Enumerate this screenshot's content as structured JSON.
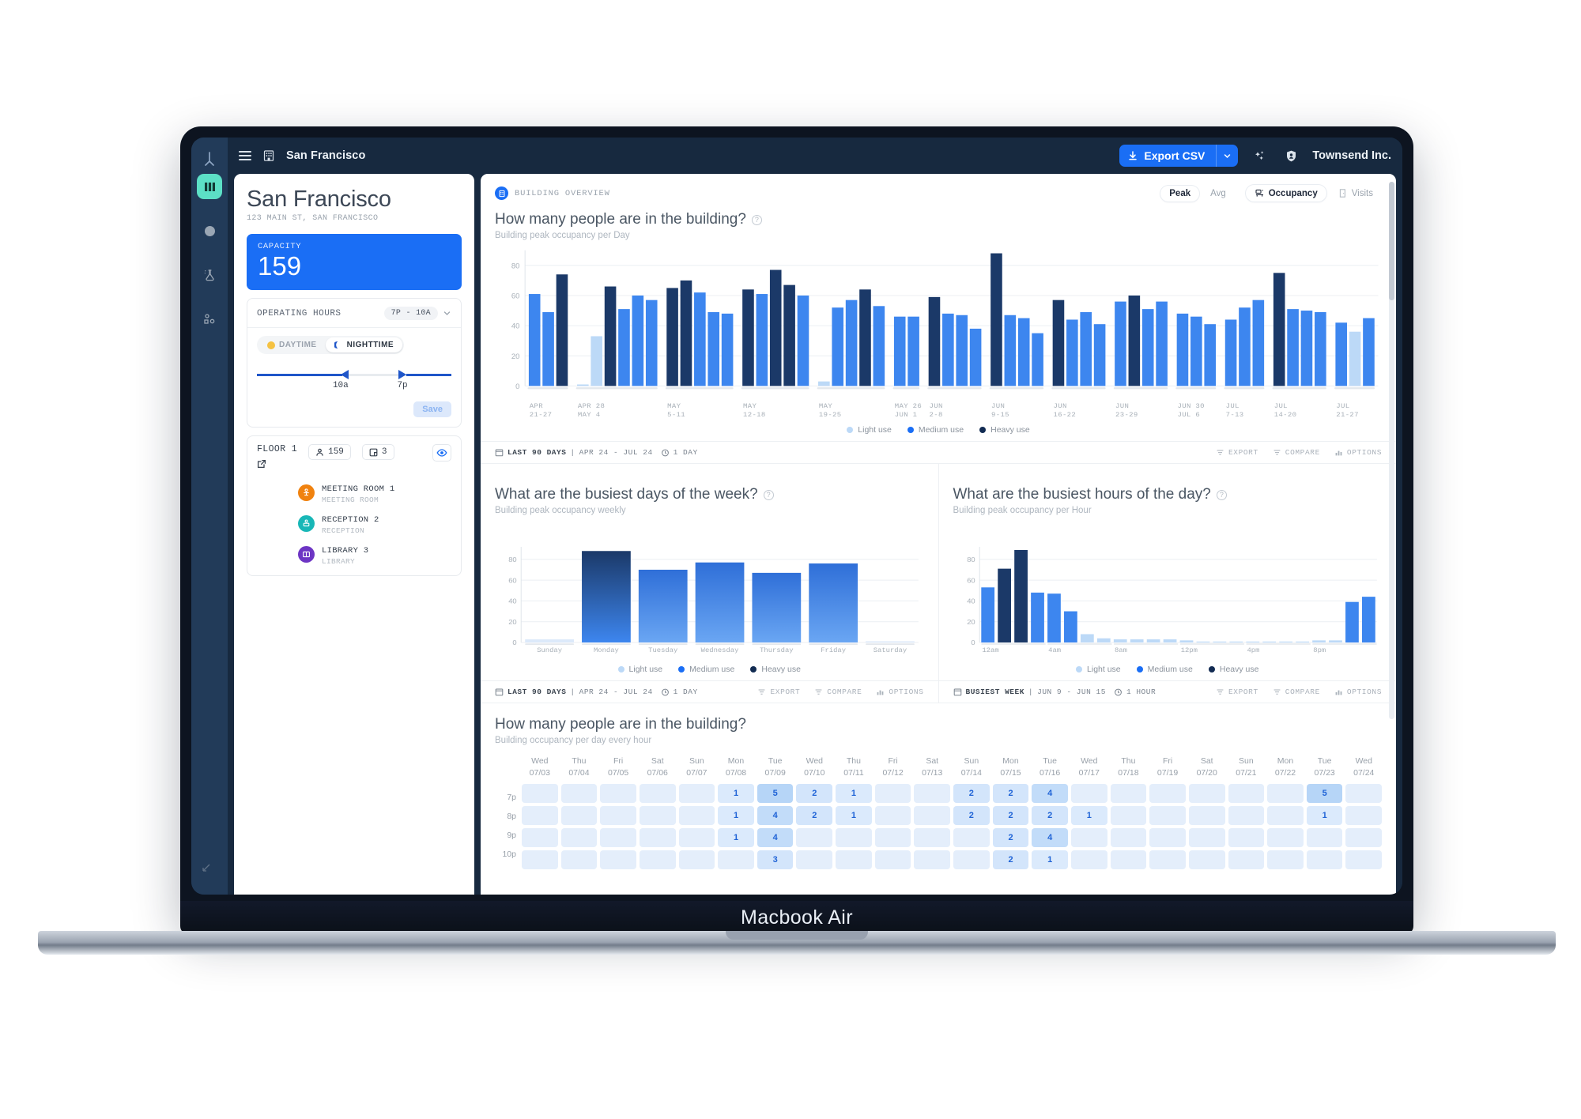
{
  "laptop": {
    "brand": "Macbook Air"
  },
  "topbar": {
    "menu_icon": "hamburger-icon",
    "building_icon": "building-icon",
    "title": "San Francisco",
    "export_label": "Export CSV",
    "export_icon": "download-icon",
    "caret_icon": "chevron-down-icon",
    "sparkle_icon": "sparkles-icon",
    "shield_icon": "shield-icon",
    "org": "Townsend Inc."
  },
  "rail": {
    "logo_icon": "brand-logo-icon",
    "items": [
      {
        "name": "dashboard-icon",
        "active": true
      },
      {
        "name": "circle-dot-icon",
        "active": false
      },
      {
        "name": "lab-flask-icon",
        "active": false
      },
      {
        "name": "nodes-icon",
        "active": false
      }
    ],
    "bottom_icon": "resize-icon"
  },
  "sidebar": {
    "site_title": "San Francisco",
    "address": "123 MAIN ST, SAN FRANCISCO",
    "capacity_label": "CAPACITY",
    "capacity_value": "159",
    "operating_hours": {
      "title": "OPERATING HOURS",
      "badge": "7P - 10A",
      "caret_icon": "chevron-down-icon",
      "daytime_label": "DAYTIME",
      "nighttime_label": "NIGHTTIME",
      "daytime_icon": "sun-icon",
      "nighttime_icon": "moon-icon",
      "active_mode": "NIGHTTIME",
      "slider_start_label": "10a",
      "slider_end_label": "7p",
      "save_label": "Save"
    },
    "floor": {
      "name": "FLOOR 1",
      "open_icon": "external-link-icon",
      "people_icon": "person-icon",
      "people_count": "159",
      "rooms_icon": "rooms-icon",
      "rooms_count": "3",
      "eye_icon": "eye-icon",
      "rooms": [
        {
          "name": "MEETING ROOM 1",
          "type": "MEETING ROOM",
          "color": "#f0820f",
          "icon": "meeting-room-icon"
        },
        {
          "name": "RECEPTION 2",
          "type": "RECEPTION",
          "color": "#18b7b7",
          "icon": "reception-icon"
        },
        {
          "name": "LIBRARY 3",
          "type": "LIBRARY",
          "color": "#6d35c4",
          "icon": "library-icon"
        }
      ]
    }
  },
  "main": {
    "breadcrumb": "BUILDING OVERVIEW",
    "breadcrumb_icon": "building-icon",
    "metric_toggle": {
      "options": [
        "Peak",
        "Avg"
      ],
      "selected": "Peak"
    },
    "view_toggle": {
      "options": [
        "Occupancy",
        "Visits"
      ],
      "selected": "Occupancy",
      "occupancy_icon": "occupancy-icon",
      "visits_icon": "door-icon"
    }
  },
  "legend": [
    {
      "label": "Light use",
      "color": "#bcd9f7"
    },
    {
      "label": "Medium use",
      "color": "#1a6ef5"
    },
    {
      "label": "Heavy use",
      "color": "#122b52"
    }
  ],
  "toolbars": {
    "daily": {
      "calendar_icon": "calendar-icon",
      "range_label": "LAST 90 DAYS",
      "range_dates": "APR 24 - JUL 24",
      "clock_icon": "clock-icon",
      "granularity": "1 DAY",
      "export": "EXPORT",
      "compare": "COMPARE",
      "options": "OPTIONS",
      "export_icon": "filter-icon",
      "compare_icon": "filter-icon",
      "options_icon": "bars-icon"
    },
    "weekly": {
      "calendar_icon": "calendar-icon",
      "range_label": "LAST 90 DAYS",
      "range_dates": "APR 24 - JUL 24",
      "clock_icon": "clock-icon",
      "granularity": "1 DAY",
      "export": "EXPORT",
      "compare": "COMPARE",
      "options": "OPTIONS"
    },
    "hourly": {
      "calendar_icon": "calendar-icon",
      "range_label": "BUSIEST WEEK",
      "range_dates": "JUN 9 - JUN 15",
      "clock_icon": "clock-icon",
      "granularity": "1 HOUR",
      "export": "EXPORT",
      "compare": "COMPARE",
      "options": "OPTIONS"
    }
  },
  "panels": {
    "daily": {
      "title": "How many people are in the building?",
      "subtitle": "Building peak occupancy per Day",
      "help_icon": "question-icon"
    },
    "weekday": {
      "title": "What are the busiest days of the week?",
      "subtitle": "Building peak occupancy weekly",
      "help_icon": "question-icon"
    },
    "hourly": {
      "title": "What are the busiest hours of the day?",
      "subtitle": "Building peak occupancy per Hour",
      "help_icon": "question-icon"
    },
    "heatmap": {
      "title": "How many people are in the building?",
      "subtitle": "Building occupancy per day every hour"
    }
  },
  "chart_data": [
    {
      "id": "daily-occupancy",
      "type": "bar",
      "title": "How many people are in the building?",
      "subtitle": "Building peak occupancy per Day",
      "xlabel": "",
      "ylabel": "",
      "ylim": [
        0,
        90
      ],
      "yticks": [
        0,
        20,
        40,
        60,
        80
      ],
      "grid": true,
      "legend": [
        "Light use",
        "Medium use",
        "Heavy use"
      ],
      "groups": [
        {
          "label": "APR\n21-27",
          "values": [
            61,
            49,
            74
          ],
          "shades": [
            "medium",
            "medium",
            "heavy"
          ]
        },
        {
          "label": "APR 28\nMAY 4",
          "values": [
            1,
            33,
            66,
            51,
            60,
            57
          ],
          "shades": [
            "light",
            "light",
            "heavy",
            "medium",
            "medium",
            "medium"
          ]
        },
        {
          "label": "MAY\n5-11",
          "values": [
            65,
            70,
            62,
            49,
            48
          ],
          "shades": [
            "heavy",
            "heavy",
            "medium",
            "medium",
            "medium"
          ]
        },
        {
          "label": "MAY\n12-18",
          "values": [
            64,
            61,
            77,
            67,
            60
          ],
          "shades": [
            "heavy",
            "medium",
            "heavy",
            "heavy",
            "medium"
          ]
        },
        {
          "label": "MAY\n19-25",
          "values": [
            3,
            52,
            57,
            64,
            53
          ],
          "shades": [
            "light",
            "medium",
            "medium",
            "heavy",
            "medium"
          ]
        },
        {
          "label": "MAY 26\nJUN 1",
          "values": [
            46,
            46
          ],
          "shades": [
            "medium",
            "medium"
          ]
        },
        {
          "label": "JUN\n2-8",
          "values": [
            59,
            48,
            47,
            38
          ],
          "shades": [
            "heavy",
            "medium",
            "medium",
            "medium"
          ]
        },
        {
          "label": "JUN\n9-15",
          "values": [
            88,
            47,
            45,
            35
          ],
          "shades": [
            "heavy",
            "medium",
            "medium",
            "medium"
          ]
        },
        {
          "label": "JUN\n16-22",
          "values": [
            57,
            44,
            49,
            41
          ],
          "shades": [
            "heavy",
            "medium",
            "medium",
            "medium"
          ]
        },
        {
          "label": "JUN\n23-29",
          "values": [
            56,
            60,
            51,
            56
          ],
          "shades": [
            "medium",
            "heavy",
            "medium",
            "medium"
          ]
        },
        {
          "label": "JUN 30\nJUL 6",
          "values": [
            48,
            46,
            41
          ],
          "shades": [
            "medium",
            "medium",
            "medium"
          ]
        },
        {
          "label": "JUL\n7-13",
          "values": [
            44,
            52,
            57
          ],
          "shades": [
            "medium",
            "medium",
            "medium"
          ]
        },
        {
          "label": "JUL\n14-20",
          "values": [
            75,
            51,
            50,
            49
          ],
          "shades": [
            "heavy",
            "medium",
            "medium",
            "medium"
          ]
        },
        {
          "label": "JUL\n21-27",
          "values": [
            42,
            36,
            45
          ],
          "shades": [
            "medium",
            "light",
            "medium"
          ]
        }
      ]
    },
    {
      "id": "busiest-weekdays",
      "type": "bar",
      "title": "What are the busiest days of the week?",
      "subtitle": "Building peak occupancy weekly",
      "categories": [
        "Sunday",
        "Monday",
        "Tuesday",
        "Wednesday",
        "Thursday",
        "Friday",
        "Saturday"
      ],
      "values": [
        3,
        88,
        70,
        77,
        67,
        76,
        0
      ],
      "ylim": [
        0,
        92
      ],
      "yticks": [
        0,
        20,
        40,
        60,
        80
      ],
      "grid": true,
      "legend": [
        "Light use",
        "Medium use",
        "Heavy use"
      ]
    },
    {
      "id": "busiest-hours",
      "type": "bar",
      "title": "What are the busiest hours of the day?",
      "subtitle": "Building peak occupancy per Hour",
      "categories": [
        "12am",
        "1am",
        "2am",
        "3am",
        "4am",
        "5am",
        "6am",
        "7am",
        "8am",
        "9am",
        "10am",
        "11am",
        "12pm",
        "1pm",
        "2pm",
        "3pm",
        "4pm",
        "5pm",
        "6pm",
        "7pm",
        "8pm",
        "9pm",
        "10pm",
        "11pm"
      ],
      "ticklabels": [
        "12am",
        "4am",
        "8am",
        "12pm",
        "4pm",
        "8pm"
      ],
      "values": [
        53,
        71,
        89,
        48,
        47,
        30,
        8,
        4,
        3,
        3,
        3,
        3,
        2,
        0,
        0,
        0,
        0,
        0,
        0,
        0,
        2,
        2,
        39,
        44
      ],
      "shades": [
        "medium",
        "heavy",
        "heavy",
        "medium",
        "medium",
        "medium",
        "light",
        "light",
        "light",
        "light",
        "light",
        "light",
        "light",
        "light",
        "light",
        "light",
        "light",
        "light",
        "light",
        "light",
        "light",
        "light",
        "medium",
        "medium"
      ],
      "ylim": [
        0,
        92
      ],
      "yticks": [
        0,
        20,
        40,
        60,
        80
      ],
      "grid": true,
      "legend": [
        "Light use",
        "Medium use",
        "Heavy use"
      ]
    },
    {
      "id": "occupancy-heatmap",
      "type": "heatmap",
      "title": "How many people are in the building?",
      "subtitle": "Building occupancy per day every hour",
      "row_labels": [
        "7p",
        "8p",
        "9p",
        "10p"
      ],
      "columns": [
        {
          "day": "Wed",
          "date": "07/03"
        },
        {
          "day": "Thu",
          "date": "07/04"
        },
        {
          "day": "Fri",
          "date": "07/05"
        },
        {
          "day": "Sat",
          "date": "07/06"
        },
        {
          "day": "Sun",
          "date": "07/07"
        },
        {
          "day": "Mon",
          "date": "07/08"
        },
        {
          "day": "Tue",
          "date": "07/09"
        },
        {
          "day": "Wed",
          "date": "07/10"
        },
        {
          "day": "Thu",
          "date": "07/11"
        },
        {
          "day": "Fri",
          "date": "07/12"
        },
        {
          "day": "Sat",
          "date": "07/13"
        },
        {
          "day": "Sun",
          "date": "07/14"
        },
        {
          "day": "Mon",
          "date": "07/15"
        },
        {
          "day": "Tue",
          "date": "07/16"
        },
        {
          "day": "Wed",
          "date": "07/17"
        },
        {
          "day": "Thu",
          "date": "07/18"
        },
        {
          "day": "Fri",
          "date": "07/19"
        },
        {
          "day": "Sat",
          "date": "07/20"
        },
        {
          "day": "Sun",
          "date": "07/21"
        },
        {
          "day": "Mon",
          "date": "07/22"
        },
        {
          "day": "Tue",
          "date": "07/23"
        },
        {
          "day": "Wed",
          "date": "07/24"
        }
      ],
      "rows": [
        {
          "hour": "7p",
          "values": [
            null,
            null,
            null,
            null,
            null,
            1,
            5,
            2,
            1,
            null,
            null,
            2,
            2,
            4,
            null,
            null,
            null,
            null,
            null,
            null,
            5,
            null
          ]
        },
        {
          "hour": "8p",
          "values": [
            null,
            null,
            null,
            null,
            null,
            1,
            4,
            2,
            1,
            null,
            null,
            2,
            2,
            2,
            1,
            null,
            null,
            null,
            null,
            null,
            1,
            null
          ]
        },
        {
          "hour": "9p",
          "values": [
            null,
            null,
            null,
            null,
            null,
            1,
            4,
            null,
            null,
            null,
            null,
            null,
            2,
            4,
            null,
            null,
            null,
            null,
            null,
            null,
            null,
            null
          ]
        },
        {
          "hour": "10p",
          "values": [
            null,
            null,
            null,
            null,
            null,
            null,
            3,
            null,
            null,
            null,
            null,
            null,
            2,
            1,
            null,
            null,
            null,
            null,
            null,
            null,
            null,
            null
          ]
        }
      ]
    }
  ]
}
